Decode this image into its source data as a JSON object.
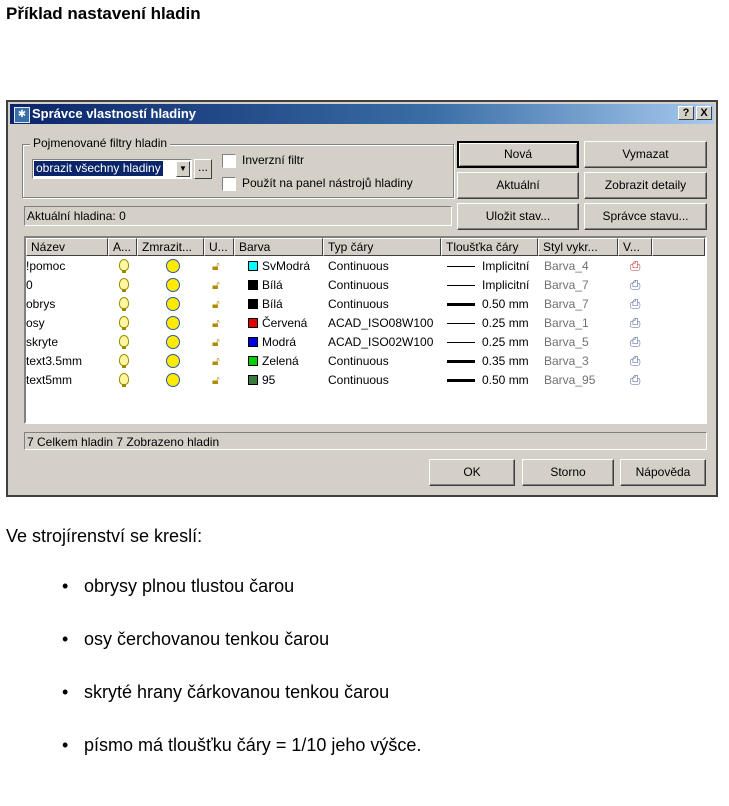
{
  "heading": "Příklad nastavení hladin",
  "dialog": {
    "title": "Správce vlastností hladiny",
    "help_btn": "?",
    "close_btn": "X",
    "filter_group_label": "Pojmenované filtry hladin",
    "filter_value": "obrazit všechny hladiny",
    "dots_label": "...",
    "inverse_filter_label": "Inverzní filtr",
    "apply_toolbar_label": "Použít na panel nástrojů hladiny",
    "current_layer": "Aktuální hladina: 0",
    "buttons": {
      "new": "Nová",
      "delete": "Vymazat",
      "current": "Aktuální",
      "show_details": "Zobrazit detaily",
      "save_state": "Uložit stav...",
      "state_manager": "Správce stavu...",
      "ok": "OK",
      "cancel": "Storno",
      "help": "Nápověda"
    },
    "columns": [
      "Název",
      "A...",
      "Zmrazit...",
      "U...",
      "Barva",
      "Typ čáry",
      "Tloušťka čáry",
      "Styl vykr...",
      "V..."
    ],
    "layers": [
      {
        "name": "!pomoc",
        "color_name": "SvModrá",
        "color_hex": "#00ffff",
        "linetype": "Continuous",
        "lineweight": "Implicitní",
        "lw_thick": false,
        "plot_style": "Barva_4",
        "plot": false
      },
      {
        "name": "0",
        "color_name": "Bílá",
        "color_hex": "#000000",
        "linetype": "Continuous",
        "lineweight": "Implicitní",
        "lw_thick": false,
        "plot_style": "Barva_7",
        "plot": true
      },
      {
        "name": "obrys",
        "color_name": "Bílá",
        "color_hex": "#000000",
        "linetype": "Continuous",
        "lineweight": "0.50 mm",
        "lw_thick": true,
        "plot_style": "Barva_7",
        "plot": true
      },
      {
        "name": "osy",
        "color_name": "Červená",
        "color_hex": "#e00000",
        "linetype": "ACAD_ISO08W100",
        "lineweight": "0.25 mm",
        "lw_thick": false,
        "plot_style": "Barva_1",
        "plot": true
      },
      {
        "name": "skryte",
        "color_name": "Modrá",
        "color_hex": "#0000e0",
        "linetype": "ACAD_ISO02W100",
        "lineweight": "0.25 mm",
        "lw_thick": false,
        "plot_style": "Barva_5",
        "plot": true
      },
      {
        "name": "text3.5mm",
        "color_name": "Zelená",
        "color_hex": "#00d000",
        "linetype": "Continuous",
        "lineweight": "0.35 mm",
        "lw_thick": true,
        "plot_style": "Barva_3",
        "plot": true
      },
      {
        "name": "text5mm",
        "color_name": "95",
        "color_hex": "#3a7a3a",
        "linetype": "Continuous",
        "lineweight": "0.50 mm",
        "lw_thick": true,
        "plot_style": "Barva_95",
        "plot": true
      }
    ],
    "summary": "7 Celkem hladin 7 Zobrazeno hladin"
  },
  "paragraph": "Ve strojírenství se kreslí:",
  "bullets": [
    "obrysy plnou tlustou čarou",
    "osy čerchovanou tenkou čarou",
    "skryté hrany čárkovanou tenkou čarou",
    "písmo má tloušťku čáry = 1/10 jeho výšce."
  ]
}
